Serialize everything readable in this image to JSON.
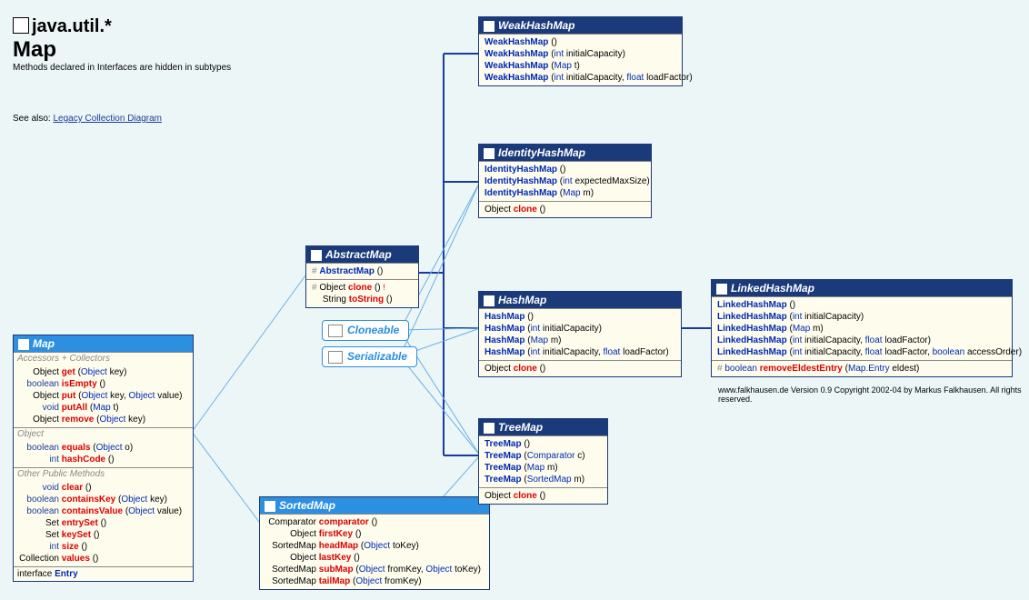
{
  "header": {
    "package": "java.util.*",
    "class": "Map",
    "note": "Methods declared in Interfaces are hidden in subtypes",
    "seealso_label": "See also:",
    "seealso_link": "Legacy Collection Diagram"
  },
  "copyright": "www.falkhausen.de Version 0.9 Copyright 2002-04 by Markus Falkhausen. All rights reserved.",
  "pills": {
    "cloneable": "Cloneable",
    "serializable": "Serializable"
  },
  "map": {
    "title": "Map",
    "groups": {
      "acc": "Accessors + Collectors",
      "obj": "Object",
      "other": "Other Public Methods"
    },
    "m_get_ret": "Object",
    "m_get_name": "get",
    "m_get_args": "(Object key)",
    "m_isEmpty_ret": "boolean",
    "m_isEmpty_name": "isEmpty",
    "m_isEmpty_args": "()",
    "m_put_ret": "Object",
    "m_put_name": "put",
    "m_put_args_a": "Object",
    "m_put_args_b": "Object",
    "m_putAll_ret": "void",
    "m_putAll_name": "putAll",
    "m_putAll_args": "Map",
    "m_remove_ret": "Object",
    "m_remove_name": "remove",
    "m_remove_args": "Object",
    "m_equals_ret": "boolean",
    "m_equals_name": "equals",
    "m_equals_args": "Object",
    "m_hash_ret": "int",
    "m_hash_name": "hashCode",
    "m_clear_ret": "void",
    "m_clear_name": "clear",
    "m_ck_ret": "boolean",
    "m_ck_name": "containsKey",
    "m_ck_args": "Object",
    "m_cv_ret": "boolean",
    "m_cv_name": "containsValue",
    "m_cv_args": "Object",
    "m_es_ret": "Set",
    "m_es_name": "entrySet",
    "m_ks_ret": "Set",
    "m_ks_name": "keySet",
    "m_size_ret": "int",
    "m_size_name": "size",
    "m_vals_ret": "Collection",
    "m_vals_name": "values",
    "inner": "Entry",
    "inner_kw": "interface"
  },
  "abstractmap": {
    "title": "AbstractMap",
    "c1_mod": "#",
    "c1_name": "AbstractMap",
    "r1_mod": "#",
    "r1_ret": "Object",
    "r1_name": "clone",
    "r1_excl": "!",
    "r2_ret": "String",
    "r2_name": "toString"
  },
  "sortedmap": {
    "title": "SortedMap",
    "r1_ret": "Comparator",
    "r1_name": "comparator",
    "r2_ret": "Object",
    "r2_name": "firstKey",
    "r3_ret": "SortedMap",
    "r3_name": "headMap",
    "r3_arg": "Object",
    "r4_ret": "Object",
    "r4_name": "lastKey",
    "r5_ret": "SortedMap",
    "r5_name": "subMap",
    "r5_arg1": "Object",
    "r5_arg2": "Object",
    "r6_ret": "SortedMap",
    "r6_name": "tailMap",
    "r6_arg": "Object"
  },
  "weakhashmap": {
    "title": "WeakHashMap",
    "c1": "WeakHashMap",
    "c1a": "()",
    "c2": "WeakHashMap",
    "c2a": "int",
    "c2p": "initialCapacity",
    "c3": "WeakHashMap",
    "c3a": "Map",
    "c3p": "t",
    "c4": "WeakHashMap",
    "c4a1": "int",
    "c4p1": "initialCapacity",
    "c4a2": "float",
    "c4p2": "loadFactor"
  },
  "identityhashmap": {
    "title": "IdentityHashMap",
    "c1": "IdentityHashMap",
    "c2": "IdentityHashMap",
    "c2a": "int",
    "c2p": "expectedMaxSize",
    "c3": "IdentityHashMap",
    "c3a": "Map",
    "c3p": "m",
    "m1_ret": "Object",
    "m1_name": "clone"
  },
  "hashmap": {
    "title": "HashMap",
    "c1": "HashMap",
    "c2": "HashMap",
    "c2a": "int",
    "c2p": "initialCapacity",
    "c3": "HashMap",
    "c3a": "Map",
    "c3p": "m",
    "c4": "HashMap",
    "c4a1": "int",
    "c4p1": "initialCapacity",
    "c4a2": "float",
    "c4p2": "loadFactor",
    "m1_ret": "Object",
    "m1_name": "clone"
  },
  "treemap": {
    "title": "TreeMap",
    "c1": "TreeMap",
    "c2": "TreeMap",
    "c2a": "Comparator",
    "c2p": "c",
    "c3": "TreeMap",
    "c3a": "Map",
    "c3p": "m",
    "c4": "TreeMap",
    "c4a": "SortedMap",
    "c4p": "m",
    "m1_ret": "Object",
    "m1_name": "clone"
  },
  "linkedhashmap": {
    "title": "LinkedHashMap",
    "c1": "LinkedHashMap",
    "c2": "LinkedHashMap",
    "c2a": "int",
    "c2p": "initialCapacity",
    "c3": "LinkedHashMap",
    "c3a": "Map",
    "c3p": "m",
    "c4": "LinkedHashMap",
    "c4a1": "int",
    "c4p1": "initialCapacity",
    "c4a2": "float",
    "c4p2": "loadFactor",
    "c5": "LinkedHashMap",
    "c5a1": "int",
    "c5p1": "initialCapacity",
    "c5a2": "float",
    "c5p2": "loadFactor",
    "c5a3": "boolean",
    "c5p3": "accessOrder",
    "m1_mod": "#",
    "m1_ret": "boolean",
    "m1_name": "removeEldestEntry",
    "m1_arg": "Map.Entry",
    "m1_p": "eldest"
  }
}
